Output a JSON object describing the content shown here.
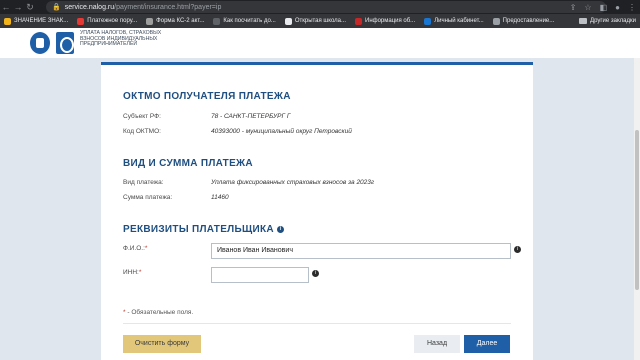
{
  "browser": {
    "url_host": "service.nalog.ru",
    "url_path": "/payment/insurance.html?payer=ip",
    "bookmarks": [
      {
        "label": "ЗНАЧЕНИЕ ЗНАК...",
        "color": "#f2b31b"
      },
      {
        "label": "Платежное пору...",
        "color": "#e53935"
      },
      {
        "label": "Форма КС-2 акт...",
        "color": "#9e9e9e"
      },
      {
        "label": "Как посчитать до...",
        "color": "#5f6368"
      },
      {
        "label": "Открытая школа...",
        "color": "#e8eaed"
      },
      {
        "label": "Информация об...",
        "color": "#c62828"
      },
      {
        "label": "Личный кабинет...",
        "color": "#1976d2"
      },
      {
        "label": "Предоставление...",
        "color": "#9aa0a6"
      }
    ],
    "other_bookmarks": "Другие закладки"
  },
  "header": {
    "service_name": "Уплата налогов, страховых взносов индивидуальных предпринимателей"
  },
  "oktmo": {
    "title": "ОКТМО ПОЛУЧАТЕЛЯ ПЛАТЕЖА",
    "subject_label": "Субъект РФ:",
    "subject_value": "78 - САНКТ-ПЕТЕРБУРГ Г",
    "code_label": "Код ОКТМО:",
    "code_value": "40393000 - муниципальный округ Петровский"
  },
  "payment": {
    "title": "ВИД И СУММА ПЛАТЕЖА",
    "type_label": "Вид платежа:",
    "type_value": "Уплата фиксированных страховых взносов за 2023г",
    "sum_label": "Сумма платежа:",
    "sum_value": "11460"
  },
  "payer": {
    "title": "РЕКВИЗИТЫ ПЛАТЕЛЬЩИКА",
    "fio_label": "Ф.И.О.:",
    "fio_value": "Иванов Иван Иванович",
    "inn_label": "ИНН:",
    "inn_value": "",
    "required_star": "*"
  },
  "footer": {
    "required_note": "- Обязательные поля.",
    "clear_button": "Очистить форму",
    "back_button": "Назад",
    "next_button": "Далее"
  }
}
